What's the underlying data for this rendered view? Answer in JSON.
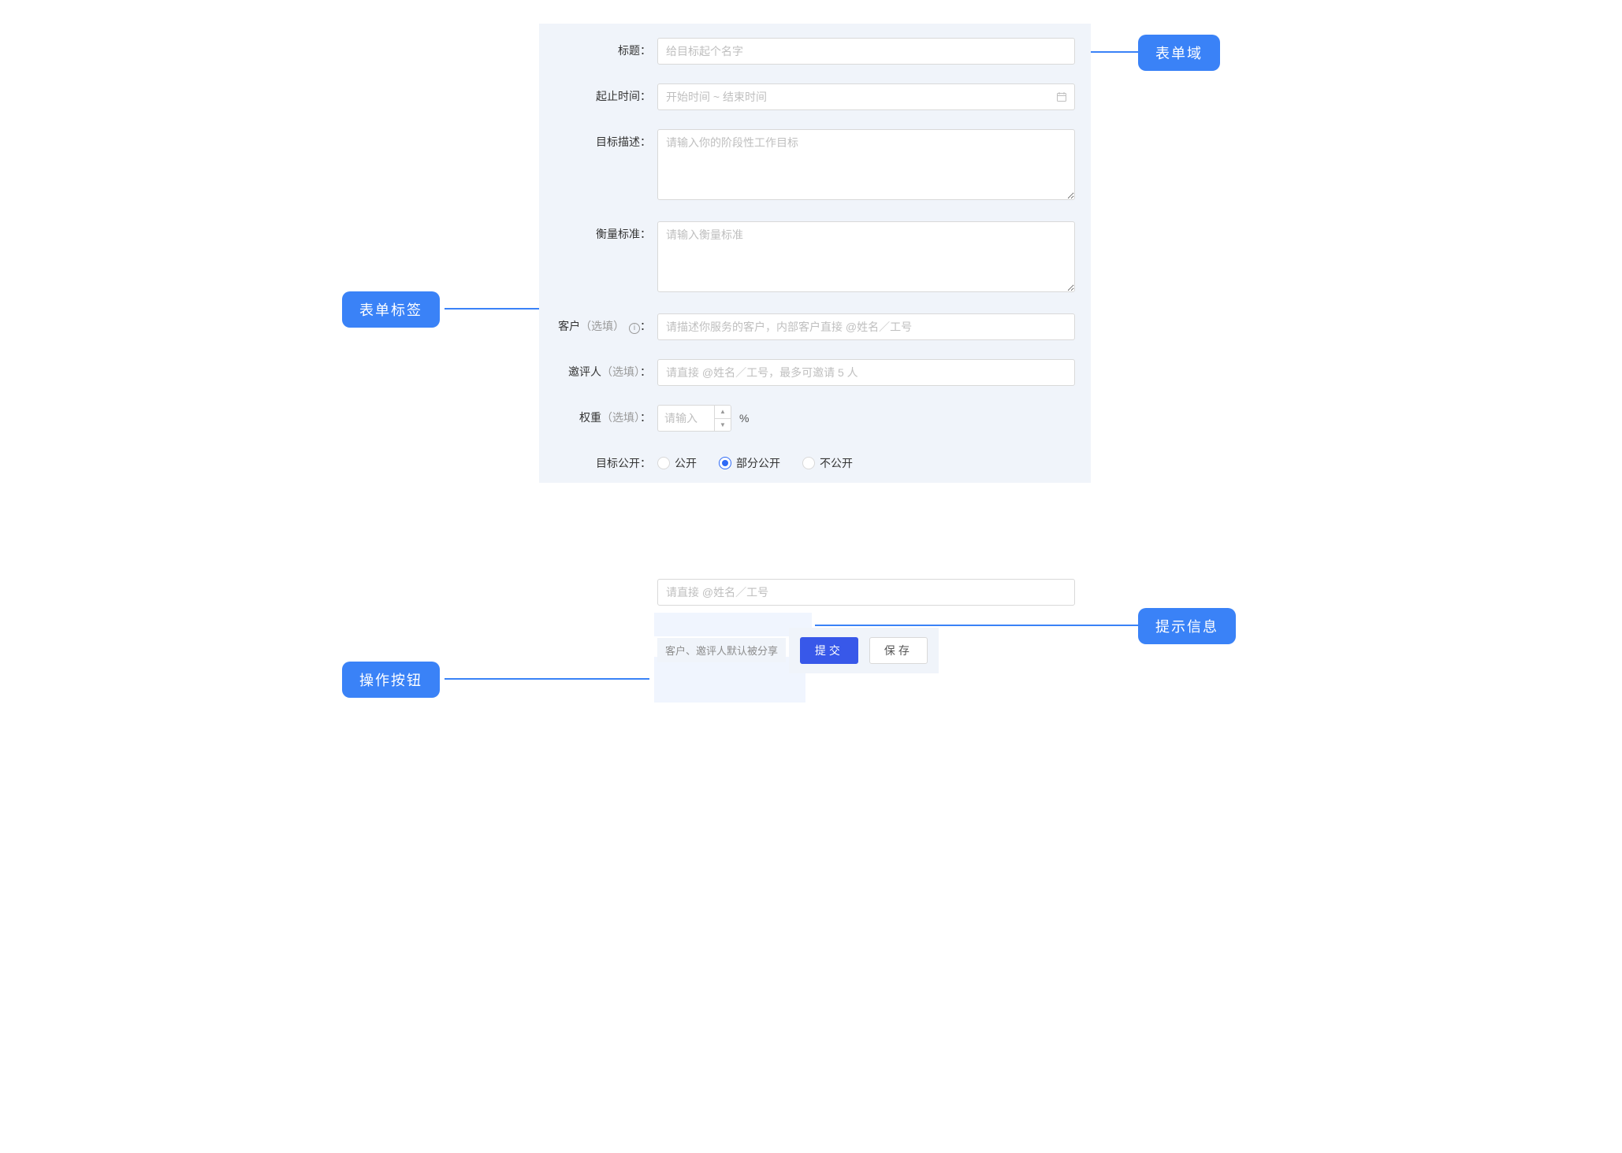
{
  "annotations": {
    "form_field": "表单域",
    "form_label": "表单标签",
    "hint_info": "提示信息",
    "action_button": "操作按钮"
  },
  "form": {
    "title": {
      "label": "标题",
      "placeholder": "给目标起个名字"
    },
    "date_range": {
      "label": "起止时间",
      "placeholder": "开始时间 ~ 结束时间"
    },
    "description": {
      "label": "目标描述",
      "placeholder": "请输入你的阶段性工作目标"
    },
    "criteria": {
      "label": "衡量标准",
      "placeholder": "请输入衡量标准"
    },
    "customer": {
      "label_main": "客户",
      "label_optional": "（选填）",
      "placeholder": "请描述你服务的客户，内部客户直接 @姓名／工号"
    },
    "reviewer": {
      "label_main": "邀评人",
      "label_optional": "（选填）",
      "placeholder": "请直接 @姓名／工号，最多可邀请 5 人"
    },
    "weight": {
      "label_main": "权重",
      "label_optional": "（选填）",
      "placeholder": "请输入",
      "suffix": "%"
    },
    "visibility": {
      "label": "目标公开",
      "options": [
        "公开",
        "部分公开",
        "不公开"
      ],
      "selected_index": 1,
      "share_placeholder": "请直接 @姓名／工号"
    },
    "hint": "客户、邀评人默认被分享",
    "buttons": {
      "submit": "提交",
      "save": "保存"
    },
    "colon": "："
  }
}
